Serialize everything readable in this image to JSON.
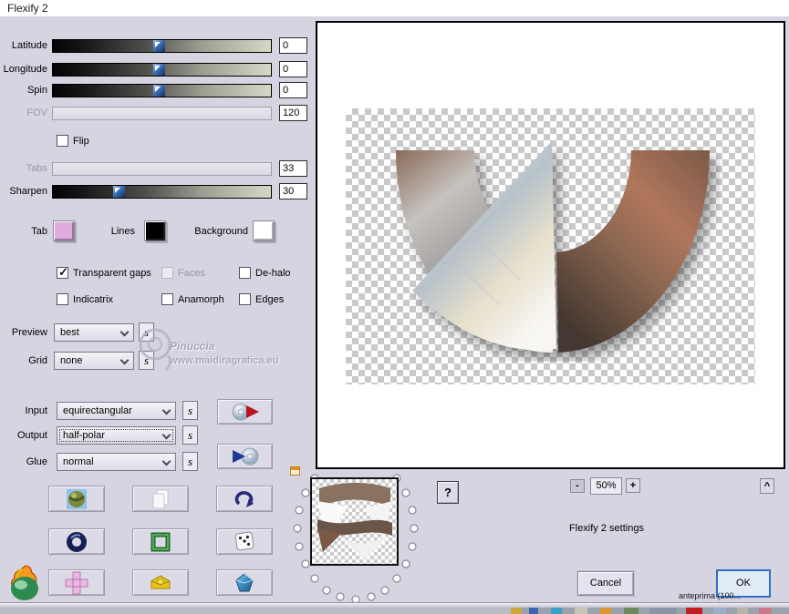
{
  "window": {
    "title": "Flexify 2"
  },
  "sliders": {
    "latitude": {
      "label": "Latitude",
      "value": "0",
      "enabled": true
    },
    "longitude": {
      "label": "Longitude",
      "value": "0",
      "enabled": true
    },
    "spin": {
      "label": "Spin",
      "value": "0",
      "enabled": true
    },
    "fov": {
      "label": "FOV",
      "value": "120",
      "enabled": false
    },
    "tabs": {
      "label": "Tabs",
      "value": "33",
      "enabled": false
    },
    "sharpen": {
      "label": "Sharpen",
      "value": "30",
      "enabled": true
    }
  },
  "flip": {
    "label": "Flip",
    "checked": false
  },
  "swatches": {
    "tab": {
      "label": "Tab",
      "color": "#dfaade"
    },
    "lines": {
      "label": "Lines",
      "color": "#000000"
    },
    "background": {
      "label": "Background",
      "color": "#ffffff"
    }
  },
  "checks": {
    "transparent_gaps": {
      "label": "Transparent gaps",
      "checked": true,
      "disabled": false
    },
    "faces": {
      "label": "Faces",
      "checked": false,
      "disabled": true
    },
    "dehalo": {
      "label": "De-halo",
      "checked": false,
      "disabled": false
    },
    "indicatrix": {
      "label": "Indicatrix",
      "checked": false,
      "disabled": false
    },
    "anamorph": {
      "label": "Anamorph",
      "checked": false,
      "disabled": false
    },
    "edges": {
      "label": "Edges",
      "checked": false,
      "disabled": false
    }
  },
  "selects": {
    "preview": {
      "label": "Preview",
      "value": "best"
    },
    "grid": {
      "label": "Grid",
      "value": "none"
    },
    "input": {
      "label": "Input",
      "value": "equirectangular"
    },
    "output": {
      "label": "Output",
      "value": "half-polar",
      "focused": true
    },
    "glue": {
      "label": "Glue",
      "value": "normal"
    },
    "s_label": "s"
  },
  "watermark": {
    "name": "Pinuccia",
    "url": "www.maidiragrafica.eu"
  },
  "zoom_bar": {
    "help": "?",
    "minus": "-",
    "level": "50%",
    "plus": "+",
    "collapse": "^"
  },
  "footer": {
    "caption": "Flexify 2 settings",
    "cancel": "Cancel",
    "ok": "OK"
  },
  "background_window": {
    "title_fragment": "anteprima (100..."
  },
  "icons": {
    "check": "✓"
  },
  "colors": {
    "dialog_bg": "#d7d4e1",
    "focus_accent": "#2f6fc4",
    "checker": "#c9c9c9",
    "slider_thumb": "#3c6cb4"
  }
}
